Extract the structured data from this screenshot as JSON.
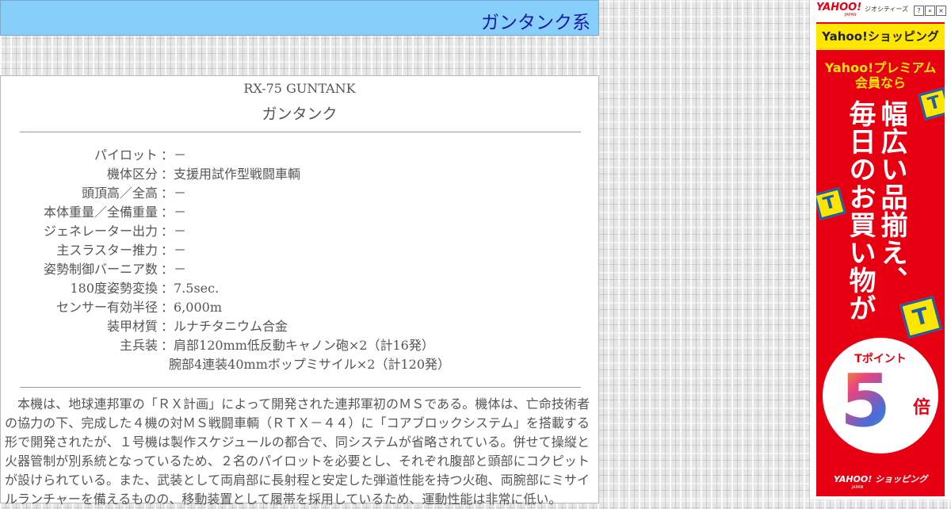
{
  "header": {
    "title": "ガンタンク系"
  },
  "unit": {
    "code": "RX-75 GUNTANK",
    "name": "ガンタンク"
  },
  "specs": [
    {
      "label": "パイロット",
      "value": "－"
    },
    {
      "label": "機体区分",
      "value": "支援用試作型戦闘車輌"
    },
    {
      "label": "頭頂高／全高",
      "value": "－"
    },
    {
      "label": "本体重量／全備重量",
      "value": "－"
    },
    {
      "label": "ジェネレーター出力",
      "value": "－"
    },
    {
      "label": "主スラスター推力",
      "value": "－"
    },
    {
      "label": "姿勢制御バーニア数",
      "value": "－"
    },
    {
      "label": "180度姿勢変換",
      "value": "7.5sec."
    },
    {
      "label": "センサー有効半径",
      "value": "6,000m"
    },
    {
      "label": "装甲材質",
      "value": "ルナチタニウム合金"
    },
    {
      "label": "主兵装",
      "value": "肩部120mm低反動キャノン砲×2（計16発）"
    },
    {
      "label": "",
      "value": "腕部4連装40mmボップミサイル×2（計120発）"
    }
  ],
  "separator": "：",
  "description": "本機は、地球連邦軍の「ＲＸ計画」によって開発された連邦軍初のＭＳである。機体は、亡命技術者の協力の下、完成した４機の対ＭＳ戦闘車輌（ＲＴＸ－４４）に「コアブロックシステム」を搭載する形で開発されたが、１号機は製作スケジュールの都合で、同システムが省略されている。併せて操縦と火器管制が別系統となっているため、２名のパイロットを必要とし、それぞれ腹部と頭部にコクピットが設けられている。また、武装として両肩部に長射程と安定した弾道性能を持つ火砲、両腕部にミサイルランチャーを備えるものの、移動装置として履帯を採用しているため、運動性能は非常に低い。",
  "ad": {
    "logo": "YAHOO!",
    "logo_sub": "JAPAN",
    "caption": "ジオシティーズ",
    "btn_help": "?",
    "btn_expand": "«",
    "btn_close": "×",
    "shop_label": "Yahoo!ショッピング",
    "premium_line1": "Yahoo!プレミアム",
    "premium_line2": "会員なら",
    "slogan_line1": "幅広い品揃え、",
    "slogan_line2": "毎日のお買い物が",
    "cube_letter": "T",
    "badge_title": "Tポイント",
    "badge_number": "5",
    "badge_unit": "倍",
    "footer_logo": "YAHOO! ショッピング",
    "footer_sub": "JAPAN",
    "colors": {
      "red": "#e60012",
      "yellow": "#ffe600",
      "blue": "#1e5fa8"
    }
  },
  "colors": {
    "header_bg": "#87cefa",
    "header_text": "#1a1aa8",
    "body_text": "#555555"
  }
}
